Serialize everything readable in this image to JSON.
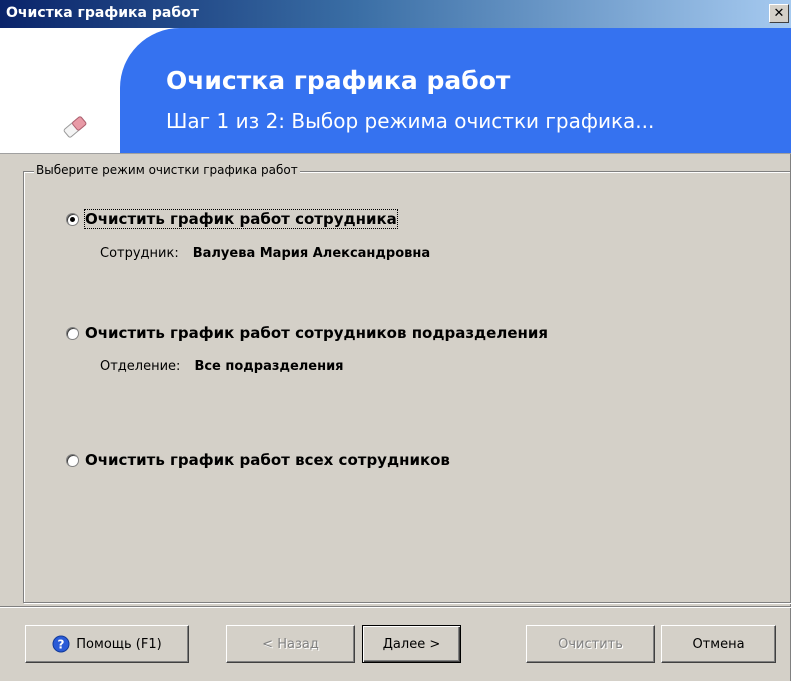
{
  "window": {
    "title": "Очистка графика работ",
    "close_glyph": "✕"
  },
  "header": {
    "title": "Очистка графика работ",
    "subtitle": "Шаг 1 из 2: Выбор режима очистки графика...",
    "icon": "eraser-icon",
    "banner_color": "#3572f0"
  },
  "group": {
    "legend": "Выберите режим очистки графика работ",
    "options": [
      {
        "label": "Очистить график работ сотрудника",
        "checked": true,
        "detail_label": "Сотрудник:",
        "detail_value": "Валуева Мария Александровна"
      },
      {
        "label": "Очистить график работ сотрудников подразделения",
        "checked": false,
        "detail_label": "Отделение:",
        "detail_value": "Все подразделения"
      },
      {
        "label": "Очистить график работ всех сотрудников",
        "checked": false
      }
    ]
  },
  "buttons": {
    "help": "Помощь (F1)",
    "back": "< Назад",
    "next": "Далее >",
    "clear": "Очистить",
    "cancel": "Отмена"
  }
}
